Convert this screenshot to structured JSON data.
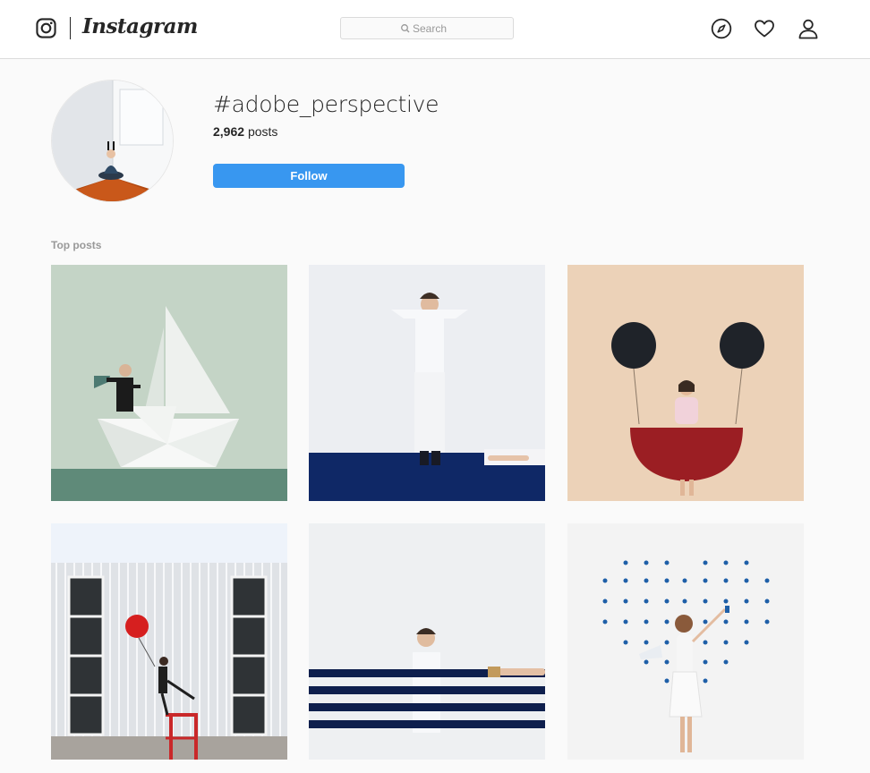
{
  "header": {
    "logo_text": "Instagram",
    "search": {
      "placeholder": "Search"
    },
    "nav": [
      "compass-icon",
      "heart-icon",
      "user-icon"
    ]
  },
  "profile": {
    "hashtag": "#adobe_perspective",
    "posts_count": "2,962",
    "posts_label": "posts",
    "follow_label": "Follow"
  },
  "sections": {
    "top_posts_label": "Top posts"
  },
  "colors": {
    "follow_blue": "#3897f0",
    "border": "#dbdbdb",
    "background": "#fafafa"
  }
}
